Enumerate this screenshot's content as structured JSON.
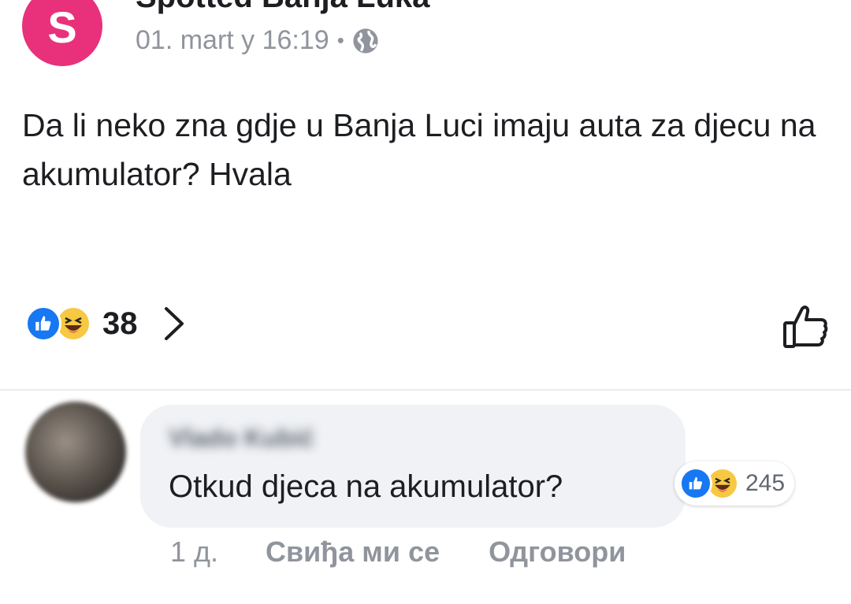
{
  "post": {
    "page_name": "Spotted Banja Luka",
    "avatar_letter": "S",
    "timestamp": "01. mart у 16:19",
    "separator": "•",
    "privacy_icon": "globe-icon",
    "text": "Da li neko zna gdje u Banja Luci imaju auta za djecu na akumulator? Hvala",
    "reaction_count": "38",
    "reaction_icons": [
      "like-icon",
      "haha-icon"
    ]
  },
  "comment": {
    "author": "Vlado Kubić",
    "text": "Otkud djeca na akumulator?",
    "reaction_count": "245",
    "reaction_icons": [
      "like-icon",
      "haha-icon"
    ],
    "time_ago": "1 д.",
    "like_label": "Свиђа ми се",
    "reply_label": "Одговори"
  },
  "colors": {
    "brand_pink": "#e8317a",
    "like_blue": "#1877f2",
    "haha_yellow": "#f7c842",
    "muted_text": "#90949c",
    "bubble_bg": "#f0f2f5"
  }
}
